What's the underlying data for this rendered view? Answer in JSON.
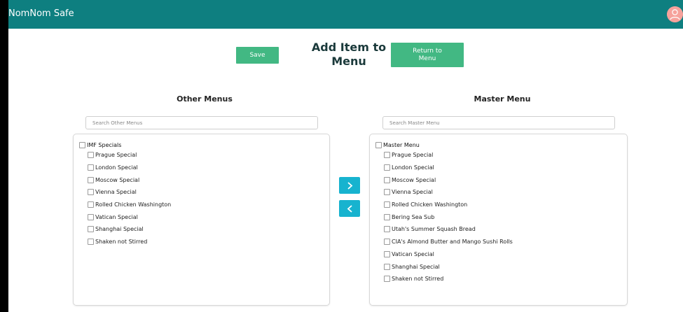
{
  "header": {
    "brand": "NomNom Safe",
    "avatar_icon": "user-avatar-icon"
  },
  "toolbar": {
    "save_label": "Save",
    "page_title": "Add Item to Menu",
    "return_label": "Return to Menu"
  },
  "other_menus": {
    "heading": "Other Menus",
    "search_placeholder": "Search Other Menus",
    "group_label": "IMF Specials",
    "items": [
      "Prague Special",
      "London Special",
      "Moscow Special",
      "Vienna Special",
      "Rolled Chicken Washington",
      "Vatican Special",
      "Shanghai Special",
      "Shaken not Stirred"
    ]
  },
  "master_menu": {
    "heading": "Master Menu",
    "search_placeholder": "Search Master Menu",
    "group_label": "Master Menu",
    "items": [
      "Prague Special",
      "London Special",
      "Moscow Special",
      "Vienna Special",
      "Rolled Chicken Washington",
      "Bering Sea Sub",
      "Utah's Summer Squash Bread",
      "CIA's Almond Butter and Mango Sushi Rolls",
      "Vatican Special",
      "Shanghai Special",
      "Shaken not Stirred"
    ]
  },
  "transfer": {
    "right_icon": "chevron-right-icon",
    "left_icon": "chevron-left-icon"
  },
  "colors": {
    "topbar": "#0e7f80",
    "button_green": "#42b883",
    "arrow_blue": "#17b3cf",
    "avatar": "#f6a29c"
  }
}
